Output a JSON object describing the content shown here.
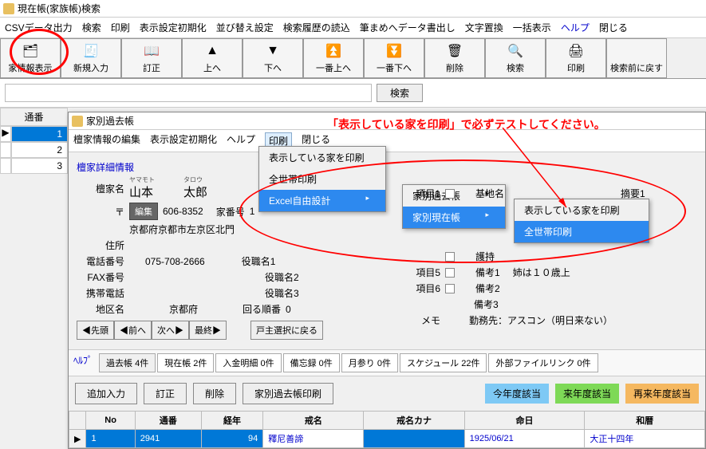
{
  "window": {
    "title": "現在帳(家族帳)検索"
  },
  "menubar": [
    "CSVデータ出力",
    "検索",
    "印刷",
    "表示設定初期化",
    "並び替え設定",
    "検索履歴の読込",
    "筆まめへデータ書出し",
    "文字置換",
    "一括表示",
    "ヘルプ",
    "閉じる"
  ],
  "toolbar": [
    {
      "label": "家情報表示",
      "icon": "🗂"
    },
    {
      "label": "新規入力",
      "icon": "🧾"
    },
    {
      "label": "訂正",
      "icon": "📖"
    },
    {
      "label": "上へ",
      "icon": "▲"
    },
    {
      "label": "下へ",
      "icon": "▼"
    },
    {
      "label": "一番上へ",
      "icon": "⏫"
    },
    {
      "label": "一番下へ",
      "icon": "⏬"
    },
    {
      "label": "削除",
      "icon": "🗑"
    },
    {
      "label": "検索",
      "icon": "🔍"
    },
    {
      "label": "印刷",
      "icon": "🖨"
    },
    {
      "label": "検索前に戻す",
      "icon": ""
    }
  ],
  "search": {
    "button": "検索"
  },
  "leftlist": {
    "header": "通番",
    "rows": [
      "1",
      "2",
      "3"
    ]
  },
  "sub": {
    "title": "家別過去帳",
    "menubar": [
      "檀家情報の編集",
      "表示設定初期化",
      "ヘルプ",
      "印刷",
      "閉じる"
    ],
    "popup1": [
      "表示している家を印刷",
      "全世帯印刷",
      "Excel自由設計"
    ],
    "popup2": [
      "家別過去帳",
      "家別現在帳"
    ],
    "popup3": [
      "表示している家を印刷",
      "全世帯印刷"
    ],
    "section": "檀家詳細情報",
    "labels": {
      "name": "檀家名",
      "postal_mark": "〒",
      "addr": "住所",
      "tel": "電話番号",
      "fax": "FAX番号",
      "mobile": "携帯電話",
      "region": "地区名",
      "edit": "編集",
      "house_no_label": "家番号",
      "house_no": "1",
      "postal": "606-8352",
      "address": "京都府京都市左京区北門",
      "phone": "075-708-2666",
      "region_val": "京都府",
      "ruby1": "ヤマモト",
      "ruby2": "タロウ",
      "name1": "山本",
      "name2": "太郎",
      "role1": "役職名1",
      "role2": "役職名2",
      "role3": "役職名3",
      "turn": "回る順番",
      "turn_val": "0",
      "item1": "項目1",
      "item2": "",
      "item3": "",
      "item4": "",
      "item5": "項目5",
      "item6": "項目6",
      "base": "基地名",
      "summary": "摘要1",
      "note1": "護持",
      "note2": "備考1",
      "note2_val": "姉は１０歳上",
      "note3": "備考2",
      "note4": "備考3",
      "memo": "メモ",
      "memo_val": "勤務先：アスコン（明日来ない）"
    },
    "nav": [
      "◀先頭",
      "◀前へ",
      "次へ▶",
      "最終▶"
    ],
    "back_btn": "戸主選択に戻る",
    "tabs_help": "ﾍﾙﾌﾟ",
    "tabs": [
      "過去帳 4件",
      "現在帳 2件",
      "入金明細 0件",
      "備忘録 0件",
      "月参り 0件",
      "スケジュール 22件",
      "外部ファイルリンク 0件"
    ],
    "actions": [
      "追加入力",
      "訂正",
      "削除",
      "家別過去帳印刷"
    ],
    "year_btns": [
      "今年度該当",
      "来年度該当",
      "再来年度該当"
    ],
    "table": {
      "headers": [
        "No",
        "通番",
        "経年",
        "戒名",
        "戒名カナ",
        "命日",
        "和暦"
      ],
      "row": [
        "1",
        "2941",
        "94",
        "釋尼善諦",
        "",
        "1925/06/21",
        "大正十四年"
      ]
    }
  },
  "annotation": "「表示している家を印刷」で必ずテストしてください。"
}
